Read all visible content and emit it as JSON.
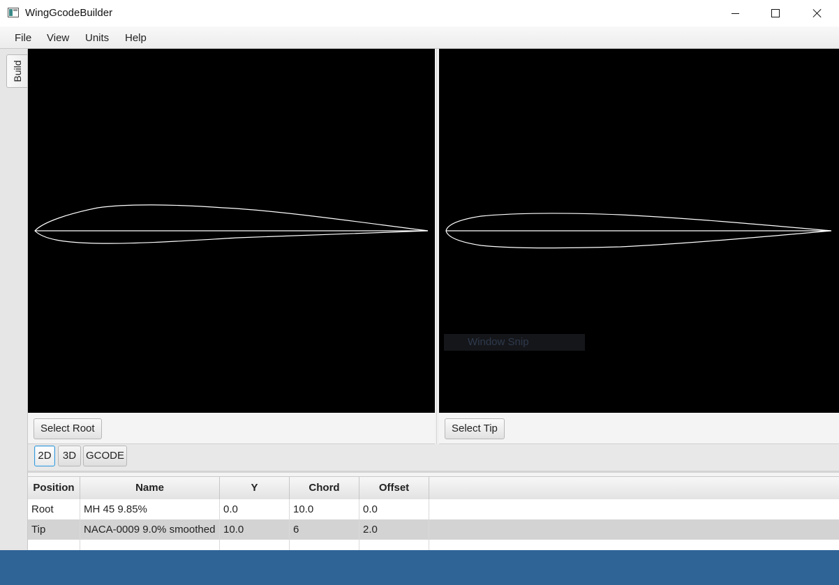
{
  "window": {
    "title": "WingGcodeBuilder"
  },
  "menu": {
    "items": [
      "File",
      "View",
      "Units",
      "Help"
    ]
  },
  "sidebar": {
    "tab_label": "Build"
  },
  "root_panel": {
    "button_label": "Select Root"
  },
  "tip_panel": {
    "button_label": "Select Tip"
  },
  "view_toggle": {
    "buttons": [
      "2D",
      "3D",
      "GCODE"
    ],
    "selected": "2D"
  },
  "table": {
    "columns": [
      "Position",
      "Name",
      "Y",
      "Chord",
      "Offset"
    ],
    "rows": [
      {
        "position": "Root",
        "name": "MH 45  9.85%",
        "y": "0.0",
        "chord": "10.0",
        "offset": "0.0"
      },
      {
        "position": "Tip",
        "name": "NACA-0009 9.0% smoothed",
        "y": "10.0",
        "chord": "6",
        "offset": "2.0"
      }
    ]
  },
  "overlay": {
    "snip_label": "Window Snip"
  },
  "colors": {
    "canvas": "#000000",
    "airfoil_stroke": "#ffffff",
    "taskbar": "#2f6497",
    "selected_border": "#3b9ad9"
  }
}
